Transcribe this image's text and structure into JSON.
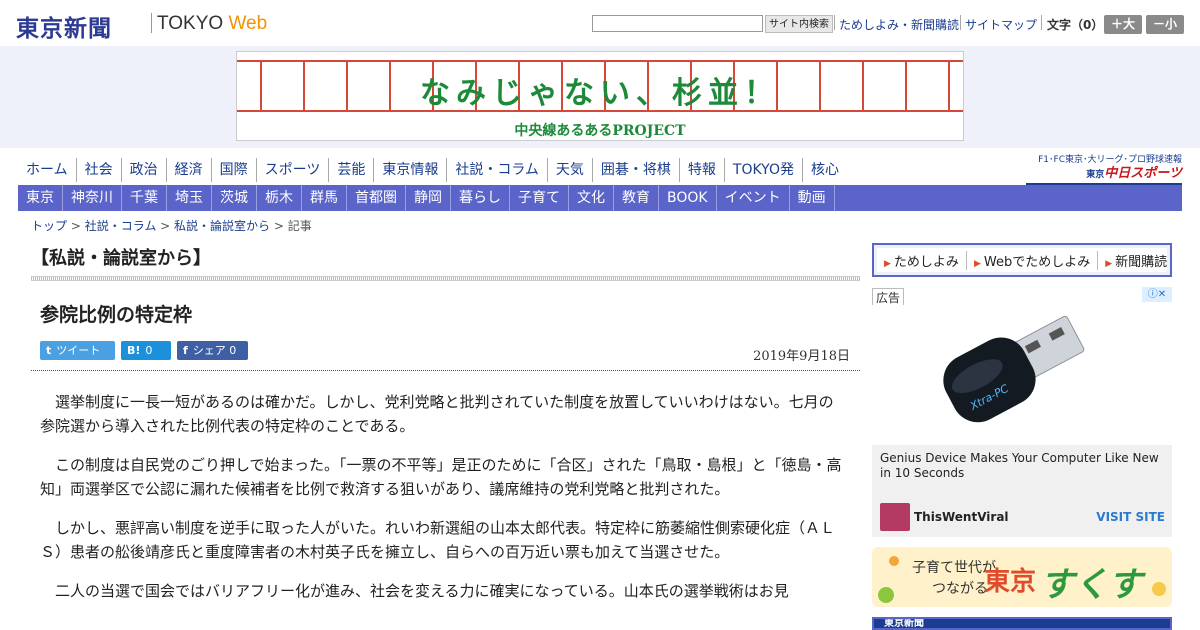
{
  "header": {
    "logo_jp": "東京新聞",
    "logo_en_a": "TOKYO ",
    "logo_en_b": "Web",
    "search_button": "サイト内検索",
    "link_trial": "ためしよみ・新聞購読",
    "link_sitemap": "サイトマップ",
    "font_size_label": "文字（0）",
    "font_bigger": "＋大",
    "font_smaller": "－小"
  },
  "banner": {
    "title": "なみじゃない、杉並！",
    "subtitle": "中央線あるあるPROJECT",
    "color": "#1d8a3a"
  },
  "nav_main": [
    "ホーム",
    "社会",
    "政治",
    "経済",
    "国際",
    "スポーツ",
    "芸能",
    "東京情報",
    "社説・コラム",
    "天気",
    "囲碁・将棋",
    "特報",
    "TOKYO発",
    "核心"
  ],
  "nav_sub": [
    "東京",
    "神奈川",
    "千葉",
    "埼玉",
    "茨城",
    "栃木",
    "群馬",
    "首都圏",
    "静岡",
    "暮らし",
    "子育て",
    "文化",
    "教育",
    "BOOK",
    "イベント",
    "動画"
  ],
  "chunichi": {
    "top": "F1･FC東京･大リーグ･プロ野球速報",
    "brand_small": "東京",
    "brand": "中日スポーツ"
  },
  "breadcrumb": {
    "top": "トップ",
    "sep": " > ",
    "l1": "社説・コラム",
    "l2": "私説・論説室から",
    "current": "記事"
  },
  "article": {
    "section": "【私説・論説室から】",
    "title": "参院比例の特定枠",
    "date": "2019年9月18日",
    "share": {
      "tweet": "ツイート",
      "hatena_count": "0",
      "fb_label": "シェア",
      "fb_count": "0"
    },
    "paragraphs": [
      "選挙制度に一長一短があるのは確かだ。しかし、党利党略と批判されていた制度を放置していいわけはない。七月の参院選から導入された比例代表の特定枠のことである。",
      "この制度は自民党のごり押しで始まった。「一票の不平等」是正のために「合区」された「鳥取・島根」と「徳島・高知」両選挙区で公認に漏れた候補者を比例で救済する狙いがあり、議席維持の党利党略と批判された。",
      "しかし、悪評高い制度を逆手に取った人がいた。れいわ新選組の山本太郎代表。特定枠に筋萎縮性側索硬化症（ＡＬＳ）患者の舩後靖彦氏と重度障害者の木村英子氏を擁立し、自らへの百万近い票も加えて当選させた。",
      "二人の当選で国会ではバリアフリー化が進み、社会を変える力に確実になっている。山本氏の選挙戦術はお見"
    ]
  },
  "sidebar": {
    "subscribe": [
      "ためしよみ",
      "Webでためしよみ",
      "新聞購読"
    ],
    "ad_label": "広告",
    "ad_headline": "Genius Device Makes Your Computer Like New in 10 Seconds",
    "ad_source": "ThisWentViral",
    "ad_cta": "VISIT SITE",
    "ad_product_text": "Xtra-PC",
    "sukusuku_line1": "子育て世代が",
    "sukusuku_line2": "つながる",
    "sukusuku_t1": "東京",
    "sukusuku_t2": "すくすく",
    "bottom_banner": "東京新聞"
  }
}
